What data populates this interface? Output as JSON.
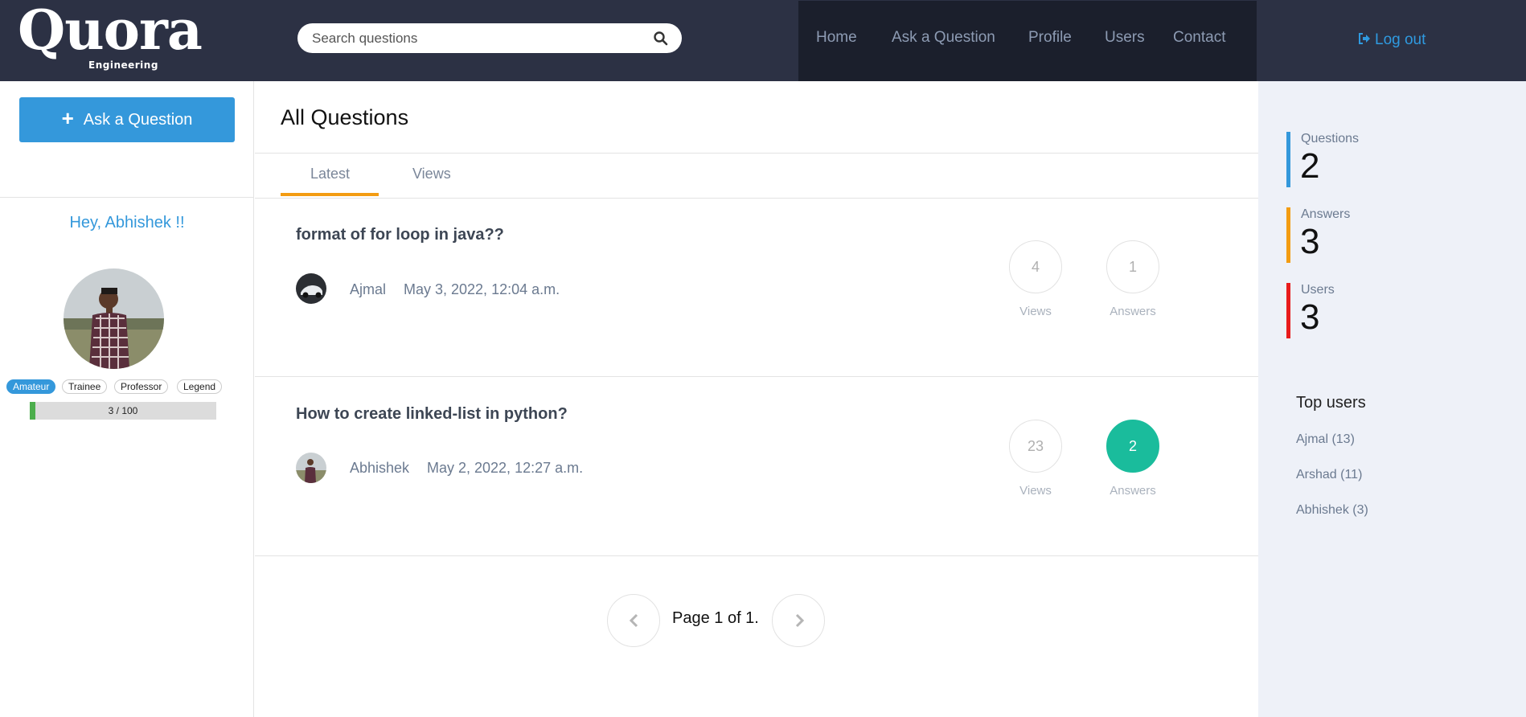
{
  "brand": {
    "name": "Quora",
    "subtitle": "Engineering"
  },
  "search": {
    "placeholder": "Search questions"
  },
  "nav": {
    "items": [
      "Home",
      "Ask a Question",
      "Profile",
      "Users",
      "Contact"
    ],
    "logout": "Log out"
  },
  "sidebar": {
    "ask_button": "Ask a Question",
    "greeting": "Hey, Abhishek !!",
    "levels": [
      "Amateur",
      "Trainee",
      "Professor",
      "Legend"
    ],
    "active_level": "Amateur",
    "progress": {
      "label": "3 / 100",
      "value": 3,
      "max": 100
    }
  },
  "main": {
    "title": "All Questions",
    "tabs": [
      "Latest",
      "Views"
    ],
    "active_tab": "Latest",
    "questions": [
      {
        "title": "format of for loop in java??",
        "author": "Ajmal",
        "date": "May 3, 2022, 12:04 a.m.",
        "views": "4",
        "views_label": "Views",
        "answers": "1",
        "answers_label": "Answers"
      },
      {
        "title": "How to create linked-list in python?",
        "author": "Abhishek",
        "date": "May 2, 2022, 12:27 a.m.",
        "views": "23",
        "views_label": "Views",
        "answers": "2",
        "answers_label": "Answers"
      }
    ],
    "pagination": "Page 1 of 1."
  },
  "stats": [
    {
      "label": "Questions",
      "value": "2",
      "color": "#3498db"
    },
    {
      "label": "Answers",
      "value": "3",
      "color": "#f39c12"
    },
    {
      "label": "Users",
      "value": "3",
      "color": "#e81c1c"
    }
  ],
  "top_users": {
    "title": "Top users",
    "items": [
      "Ajmal (13)",
      "Arshad (11)",
      "Abhishek (3)"
    ]
  },
  "colors": {
    "header": "#2c3144",
    "nav": "#1b1f2c",
    "accent": "#3498db",
    "tab_active": "#f39c12",
    "answered": "#1abc9c"
  }
}
